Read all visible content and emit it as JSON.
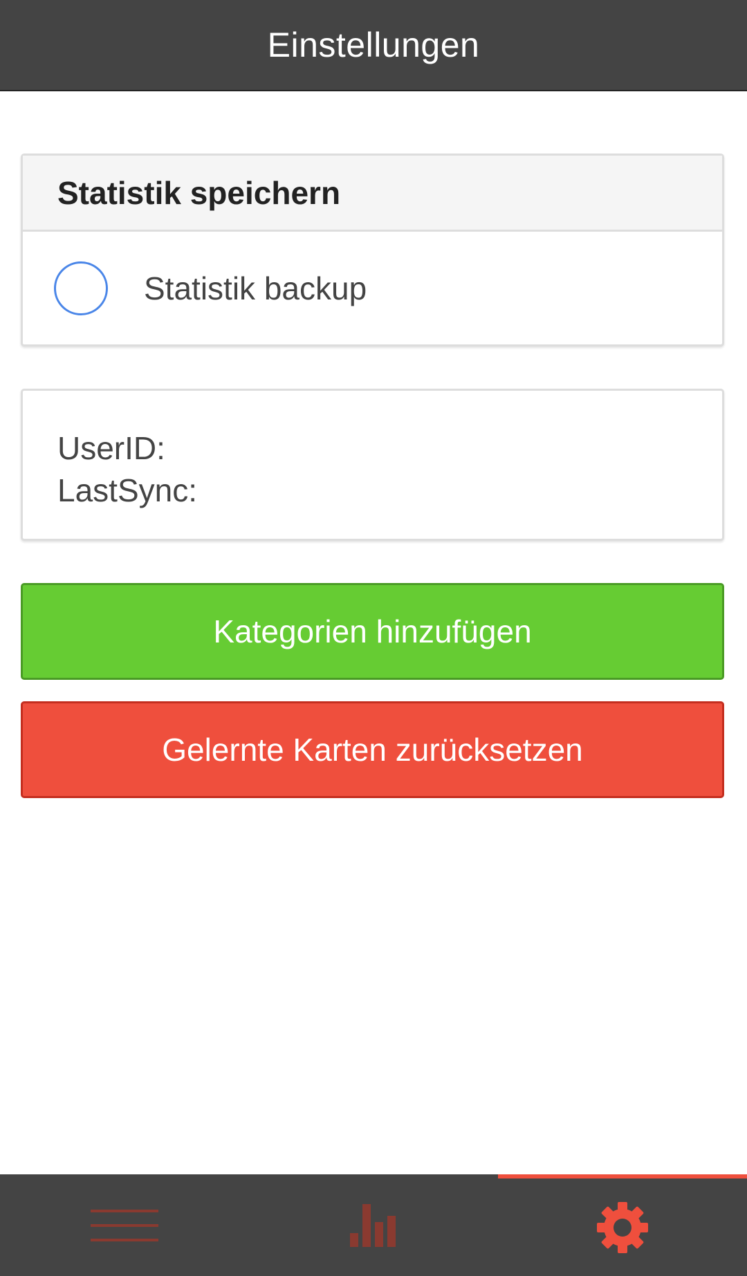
{
  "header": {
    "title": "Einstellungen"
  },
  "statistics_card": {
    "title": "Statistik speichern",
    "backup_label": "Statistik backup",
    "backup_checked": false
  },
  "info_card": {
    "userid_label": "UserID:",
    "lastsync_label": "LastSync:"
  },
  "buttons": {
    "add_categories": "Kategorien hinzufügen",
    "reset_cards": "Gelernte Karten zurücksetzen"
  },
  "tabbar": {
    "tabs": [
      {
        "icon": "menu-icon",
        "active": false
      },
      {
        "icon": "bar-chart-icon",
        "active": false
      },
      {
        "icon": "gear-icon",
        "active": true
      }
    ]
  },
  "colors": {
    "header_bg": "#444444",
    "accent_red": "#ef4f3d",
    "button_green": "#66cc33",
    "radio_blue": "#4a86e8",
    "icon_inactive": "#8a3a30"
  }
}
